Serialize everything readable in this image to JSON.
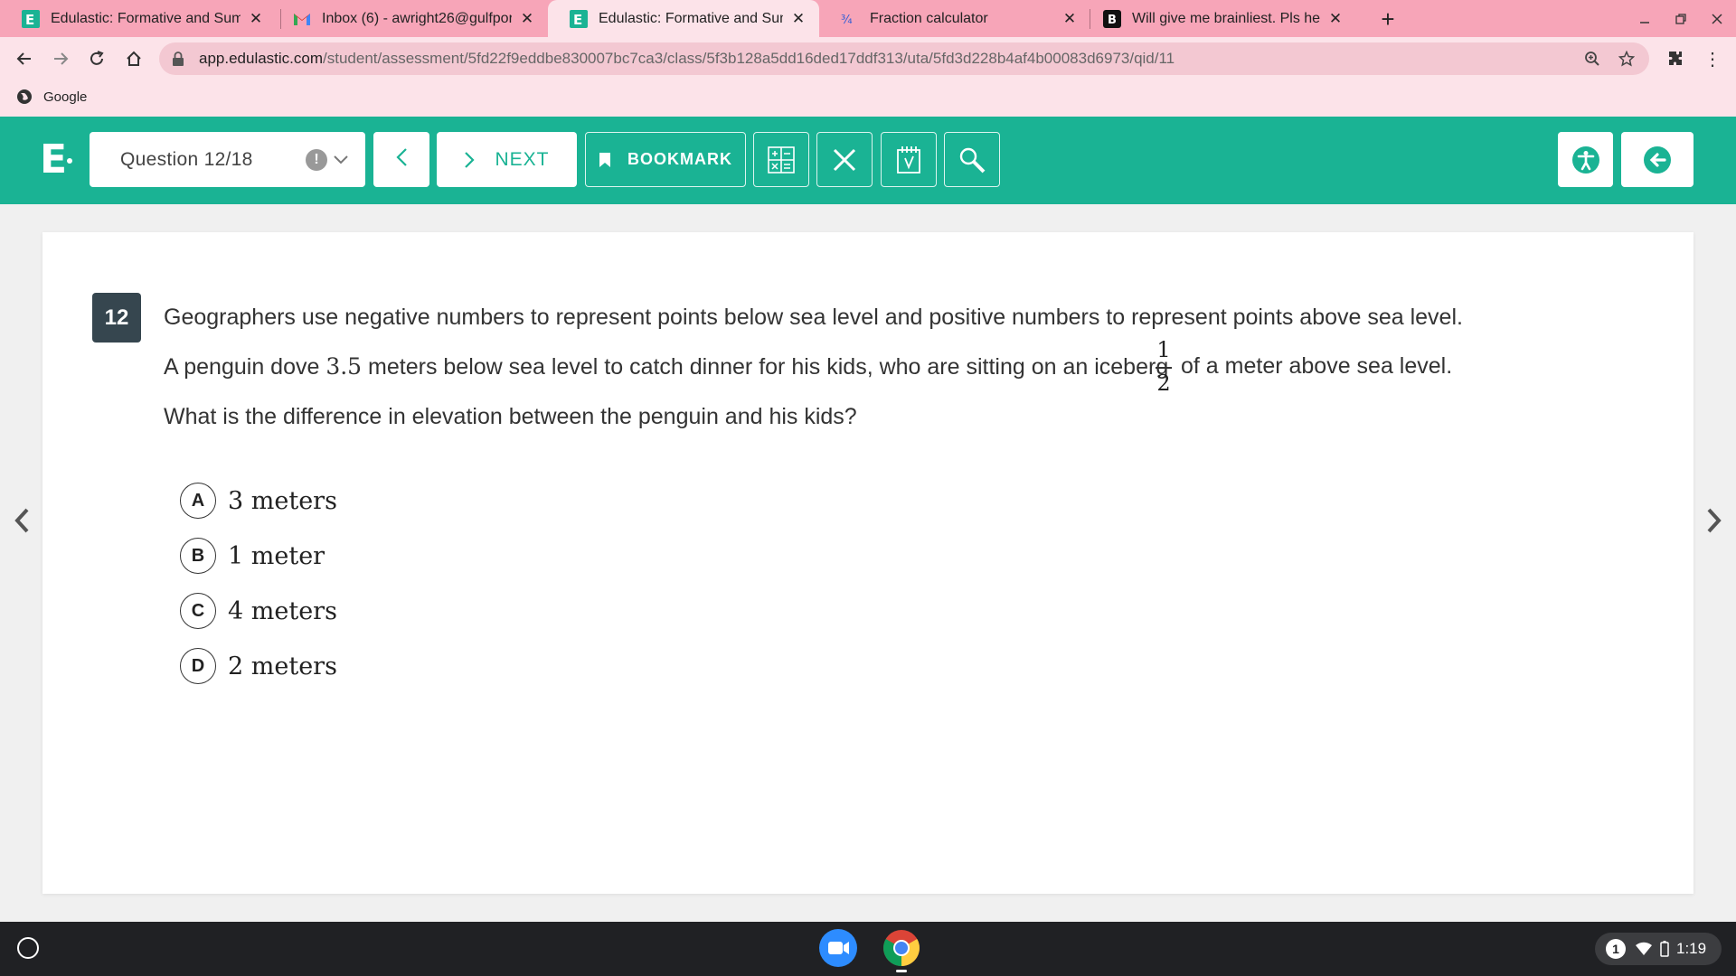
{
  "browser": {
    "tabs": [
      {
        "title": "Edulastic: Formative and Summa",
        "favicon": "edulastic-icon",
        "active": false
      },
      {
        "title": "Inbox (6) - awright26@gulfportsc",
        "favicon": "gmail-icon",
        "active": false
      },
      {
        "title": "Edulastic: Formative and Summa",
        "favicon": "edulastic-icon",
        "active": true
      },
      {
        "title": "Fraction calculator",
        "favicon": "fraction-icon",
        "active": false
      },
      {
        "title": "Will give me brainliest. Pls help -",
        "favicon": "brainly-icon",
        "active": false
      }
    ],
    "new_tab_symbol": "+",
    "url_host": "app.edulastic.com",
    "url_path": "/student/assessment/5fd22f9eddbe830007bc7ca3/class/5f3b128a5dd16ded17ddf313/uta/5fd3d228b4af4b00083d6973/qid/11",
    "bookmarks": [
      {
        "label": "Google"
      }
    ]
  },
  "header": {
    "logo": "E",
    "question_selector": "Question 12/18",
    "next_label": "NEXT",
    "bookmark_label": "BOOKMARK",
    "accent_color": "#1ab394"
  },
  "question": {
    "number": "12",
    "line1": "Geographers use negative numbers to represent points below sea level and positive numbers to represent points above sea level.",
    "line2_before": "A penguin dove ",
    "line2_value": "3.5",
    "line2_middle": " meters below sea level to catch dinner for his kids, who are sitting on an iceberg",
    "fraction_numerator": "1",
    "fraction_denominator": "2",
    "line2_after": "of a meter above sea level.",
    "line3": "What is the difference in elevation between the penguin and his kids?",
    "choices": [
      {
        "letter": "A",
        "text": "3 meters"
      },
      {
        "letter": "B",
        "text": "1 meter"
      },
      {
        "letter": "C",
        "text": "4 meters"
      },
      {
        "letter": "D",
        "text": "2 meters"
      }
    ]
  },
  "system_tray": {
    "notification_count": "1",
    "time": "1:19"
  }
}
